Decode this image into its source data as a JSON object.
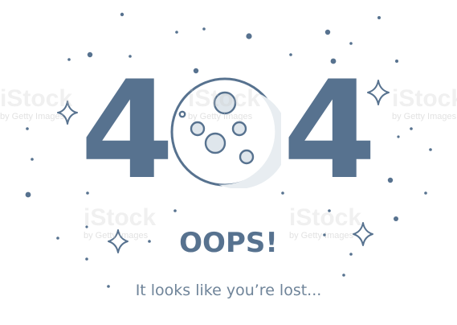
{
  "error": {
    "code_left_digit": "4",
    "code_right_digit": "4",
    "headline": "OOPS!",
    "message": "It looks like you’re lost..."
  },
  "watermarks": [
    {
      "brand": "iStock",
      "credit": "by Getty Images"
    },
    {
      "brand": "iStock",
      "credit": "by Getty Images"
    },
    {
      "brand": "iStock",
      "credit": "by Getty Images"
    },
    {
      "brand": "iStock",
      "credit": "by Getty Images"
    },
    {
      "brand": "iStock",
      "credit": "by Getty Images"
    }
  ],
  "icons": {
    "moon": "moon-icon",
    "sparkle": "sparkle-icon",
    "star_dot": "star-dot-icon"
  },
  "colors": {
    "primary": "#57728f",
    "text_secondary": "#6f8499",
    "moon_shadow": "#e8edf1",
    "background": "#ffffff"
  }
}
